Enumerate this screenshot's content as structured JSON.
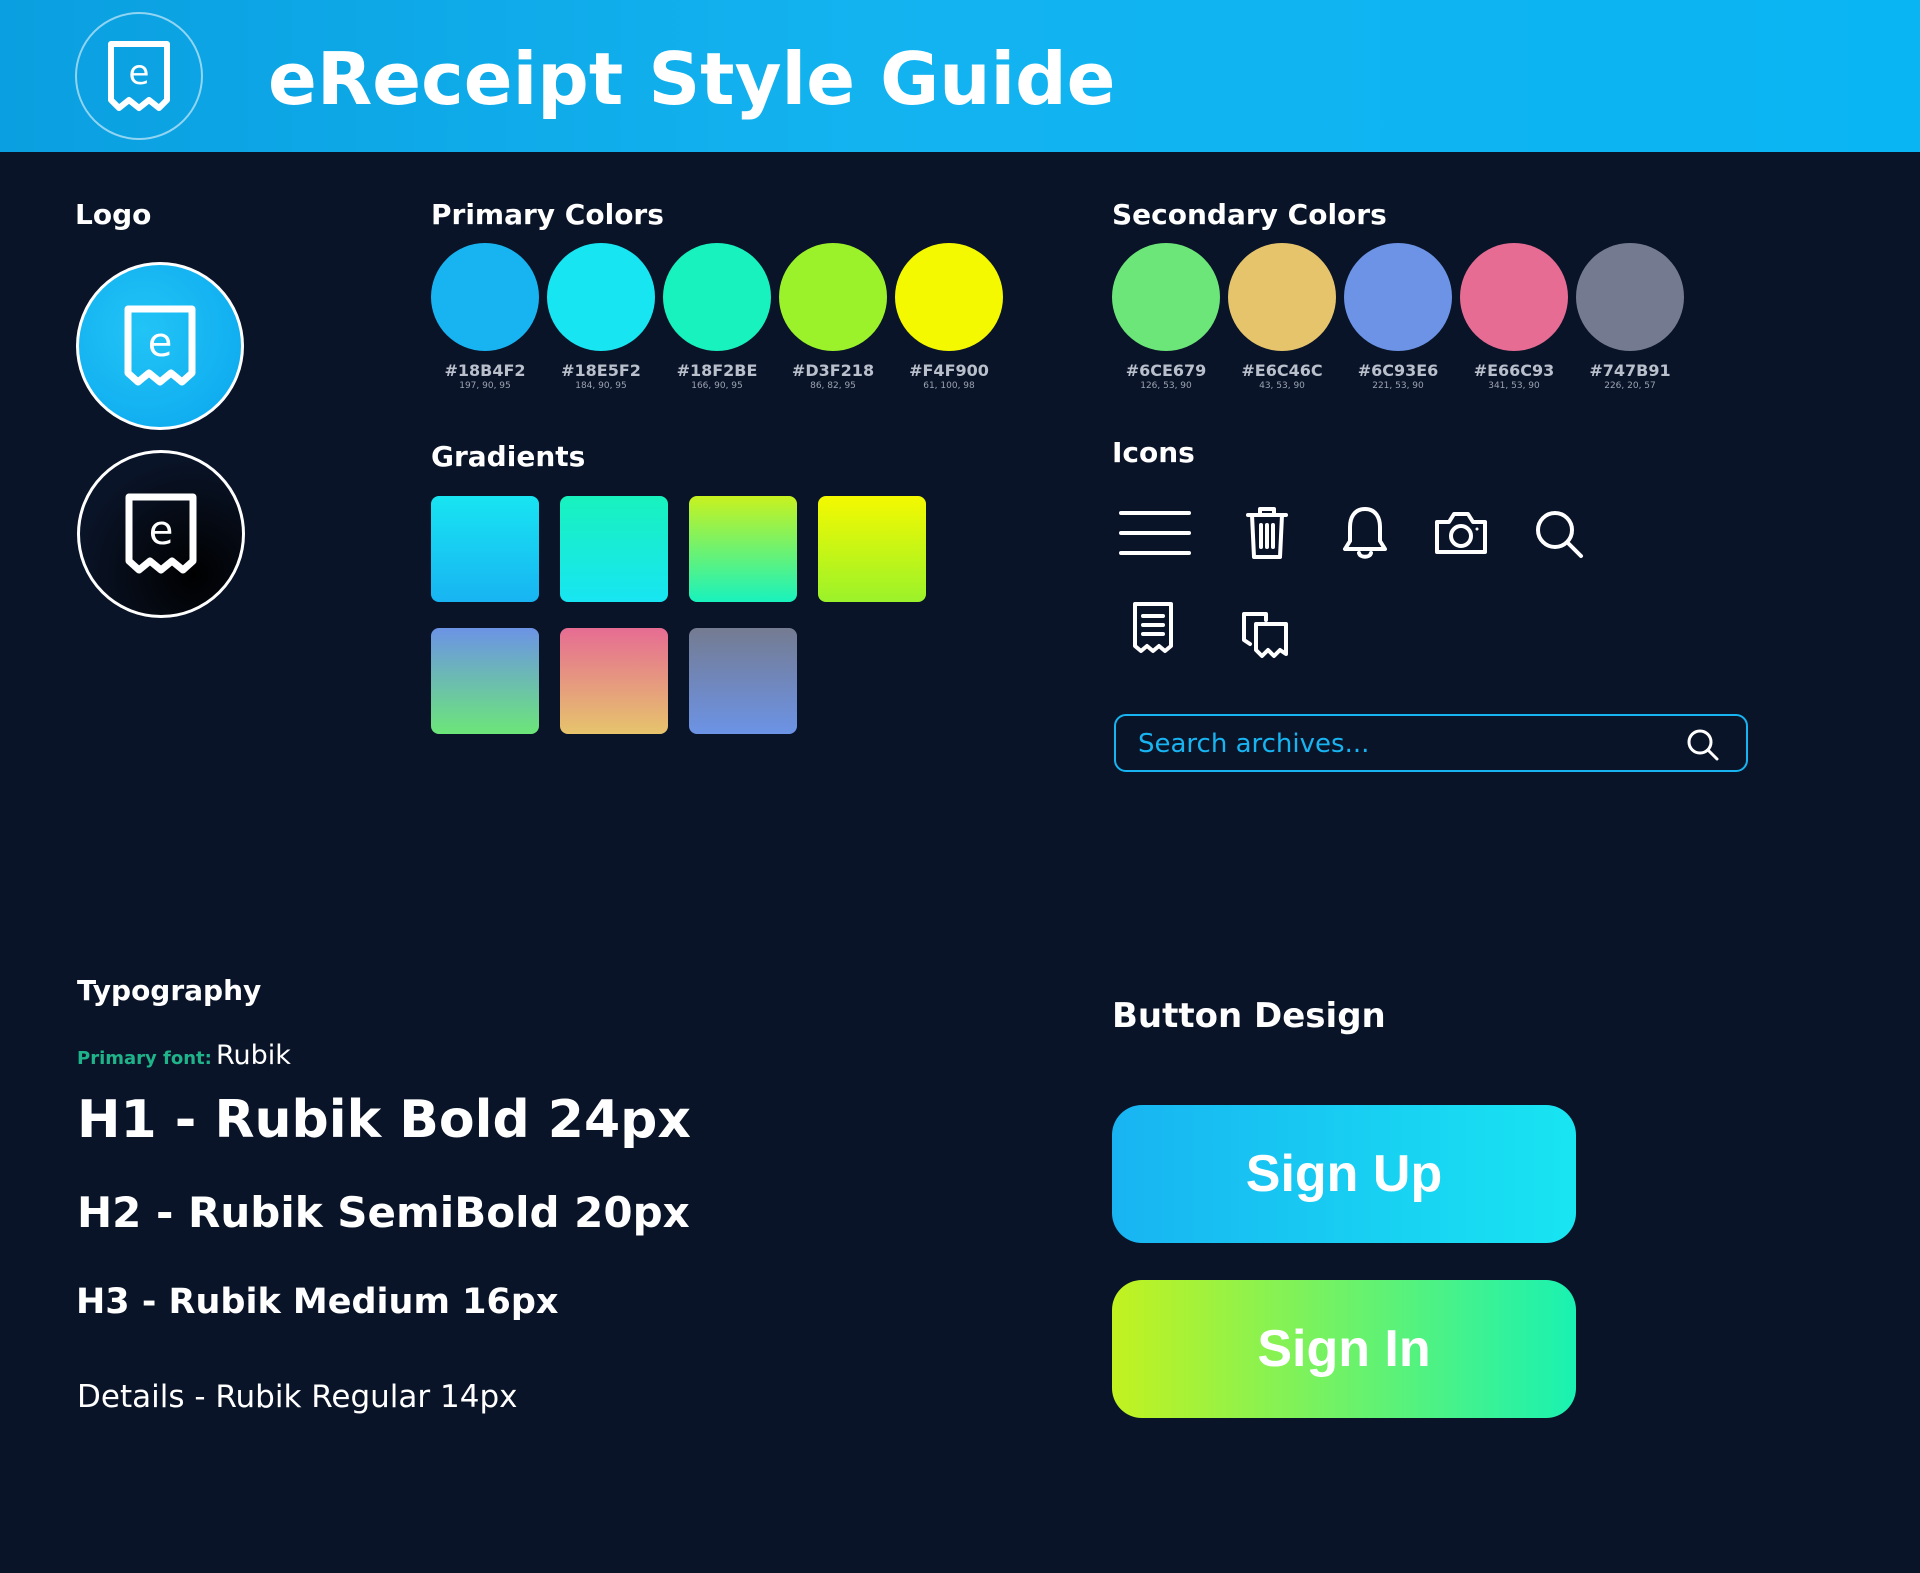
{
  "header": {
    "title": "eReceipt Style Guide",
    "logo_icon": "receipt-e-icon"
  },
  "sections": {
    "logo": "Logo",
    "primary_colors": "Primary Colors",
    "secondary_colors": "Secondary Colors",
    "gradients": "Gradients",
    "icons": "Icons",
    "typography": "Typography",
    "button_design": "Button Design"
  },
  "primary_colors": [
    {
      "hex": "#18B4F2",
      "hsb": "197, 90, 95",
      "color": "#18B4F2"
    },
    {
      "hex": "#18E5F2",
      "hsb": "184, 90, 95",
      "color": "#18E5F2"
    },
    {
      "hex": "#18F2BE",
      "hsb": "166, 90, 95",
      "color": "#18F2BE"
    },
    {
      "hex": "#D3F218",
      "hsb": "86, 82, 95",
      "color": "#9BF22A"
    },
    {
      "hex": "#F4F900",
      "hsb": "61, 100, 98",
      "color": "#F4F900"
    }
  ],
  "secondary_colors": [
    {
      "hex": "#6CE679",
      "hsb": "126, 53, 90",
      "color": "#6CE679"
    },
    {
      "hex": "#E6C46C",
      "hsb": "43, 53, 90",
      "color": "#E6C46C"
    },
    {
      "hex": "#6C93E6",
      "hsb": "221, 53, 90",
      "color": "#6C93E6"
    },
    {
      "hex": "#E66C93",
      "hsb": "341, 53, 90",
      "color": "#E66C93"
    },
    {
      "hex": "#747B91",
      "hsb": "226, 20, 57",
      "color": "#747B91"
    }
  ],
  "gradients": [
    {
      "from": "#18E5F2",
      "to": "#18B4F2"
    },
    {
      "from": "#18F2BE",
      "to": "#18E5F2"
    },
    {
      "from": "#C8F21F",
      "to": "#18F2BE"
    },
    {
      "from": "#F4F900",
      "to": "#9BF22A"
    },
    {
      "from": "#6C93E6",
      "to": "#6CE679"
    },
    {
      "from": "#E66C93",
      "to": "#E6C46C"
    },
    {
      "from": "#747B91",
      "to": "#6C93E6"
    }
  ],
  "icons": [
    "menu-icon",
    "trash-icon",
    "bell-icon",
    "camera-icon",
    "search-icon",
    "receipt-icon",
    "receipts-copy-icon"
  ],
  "search": {
    "placeholder": "Search archives..."
  },
  "typography": {
    "primary_font_label": "Primary font:",
    "primary_font_value": "Rubik",
    "h1": "H1 - Rubik Bold 24px",
    "h2": "H2 - Rubik SemiBold 20px",
    "h3": "H3 - Rubik Medium 16px",
    "details": "Details - Rubik Regular 14px"
  },
  "buttons": {
    "sign_up": "Sign Up",
    "sign_in": "Sign In"
  }
}
